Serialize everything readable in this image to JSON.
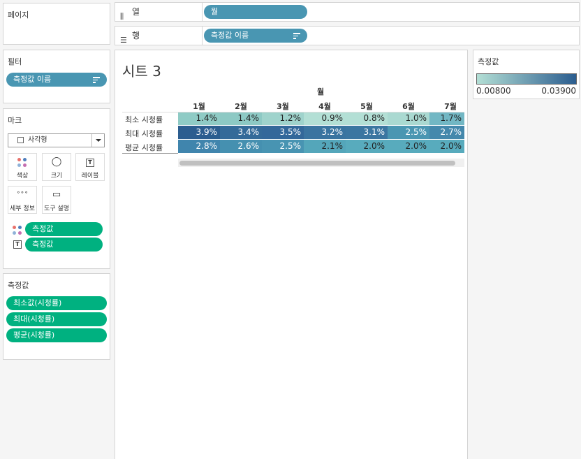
{
  "shelves": {
    "pages_title": "페이지",
    "columns_label": "열",
    "columns_pill": "월",
    "rows_label": "행",
    "rows_pill": "측정값 이름"
  },
  "filters": {
    "title": "필터",
    "pill": "측정값 이름"
  },
  "marks": {
    "title": "마크",
    "mark_type": "사각형",
    "buttons": {
      "color": "색상",
      "size": "크기",
      "label": "레이블",
      "detail": "세부 정보",
      "tooltip": "도구 설명"
    },
    "color_pill": "측정값",
    "label_pill": "측정값"
  },
  "measure_values": {
    "title": "측정값",
    "pills": [
      "최소값(시청률)",
      "최대(시청률)",
      "평균(시청률)"
    ]
  },
  "sheet": {
    "title": "시트 3",
    "col_group_label": "월",
    "months": [
      "1월",
      "2월",
      "3월",
      "4월",
      "5월",
      "6월",
      "7월"
    ],
    "rows": [
      {
        "label": "최소 시청률",
        "values": [
          "1.4%",
          "1.4%",
          "1.2%",
          "0.9%",
          "0.8%",
          "1.0%",
          "1.7%"
        ],
        "colors": [
          "#8fcbc5",
          "#8dc9c4",
          "#9fd3cc",
          "#b3dfd5",
          "#b3dfd5",
          "#aad9d1",
          "#72b7c4"
        ]
      },
      {
        "label": "최대 시청률",
        "values": [
          "3.9%",
          "3.4%",
          "3.5%",
          "3.2%",
          "3.1%",
          "2.5%",
          "2.7%"
        ],
        "colors": [
          "#2b5d8f",
          "#346a99",
          "#33689a",
          "#3a74a0",
          "#3b76a1",
          "#4a96b2",
          "#4488ac"
        ]
      },
      {
        "label": "평균 시청률",
        "values": [
          "2.8%",
          "2.6%",
          "2.5%",
          "2.1%",
          "2.0%",
          "2.0%",
          "2.0%"
        ],
        "colors": [
          "#4085ad",
          "#4590b0",
          "#4894b2",
          "#54a6ba",
          "#58abbd",
          "#58abbd",
          "#58abbd"
        ]
      }
    ]
  },
  "legend": {
    "title": "측정값",
    "min_label": "0.00800",
    "max_label": "0.03900",
    "color_start": "#b3dfd5",
    "color_end": "#2b5d8f"
  }
}
